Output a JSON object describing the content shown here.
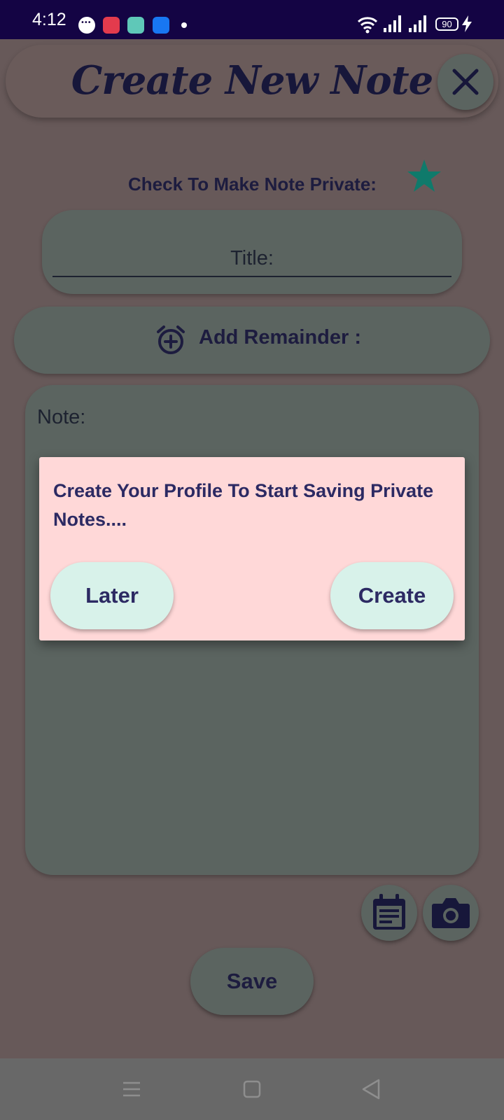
{
  "status_bar": {
    "time": "4:12",
    "battery": "90",
    "icons": [
      "message-icon",
      "screen-record-icon",
      "gallery-icon",
      "usb-icon",
      "dot-icon",
      "wifi-icon",
      "signal-icon",
      "signal-icon",
      "battery-icon",
      "charging-icon"
    ]
  },
  "header": {
    "title": "Create New Note",
    "close_icon": "close-icon"
  },
  "form": {
    "private_label": "Check To Make Note Private:",
    "private_icon": "star-icon",
    "title_placeholder": "Title:",
    "reminder_label": "Add Remainder :",
    "reminder_icon": "alarm-add-icon",
    "note_placeholder": "Note:"
  },
  "actions": {
    "calendar_icon": "calendar-note-icon",
    "camera_icon": "camera-icon",
    "save_label": "Save"
  },
  "dialog": {
    "message": "Create Your Profile To Start Saving Private Notes....",
    "later_label": "Later",
    "create_label": "Create"
  },
  "colors": {
    "status_bar": "#140444",
    "accent_star": "#0f7a6b",
    "dialog_bg": "#ffd8d8",
    "dialog_button": "#d8f2ea",
    "dialog_text": "#2c2a63"
  },
  "nav_bar": {
    "items": [
      "menu-icon",
      "home-icon",
      "back-icon"
    ]
  }
}
